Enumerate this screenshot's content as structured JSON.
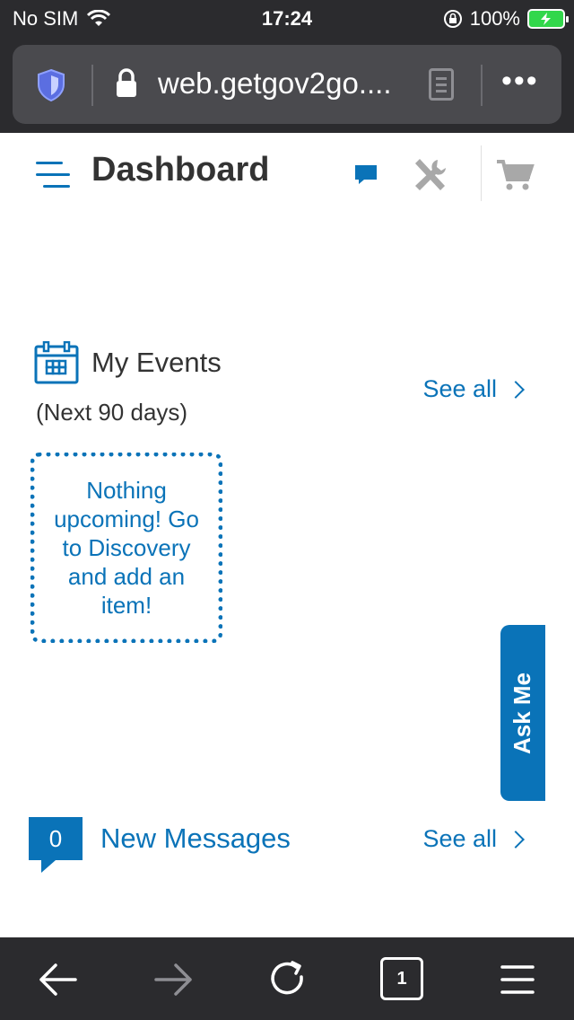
{
  "status_bar": {
    "carrier": "No SIM",
    "time": "17:24",
    "battery": "100%"
  },
  "browser": {
    "url": "web.getgov2go...."
  },
  "header": {
    "title": "Dashboard"
  },
  "events": {
    "title": "My Events",
    "subtitle": "(Next 90 days)",
    "see_all": "See all",
    "empty_text": "Nothing upcoming! Go to Discovery and add an item!"
  },
  "ask_me": {
    "label": "Ask Me"
  },
  "messages": {
    "count": "0",
    "title": "New Messages",
    "see_all": "See all"
  },
  "toolbar": {
    "tab_count": "1"
  },
  "colors": {
    "accent": "#0a73b8",
    "chrome": "#2b2b2e",
    "battery": "#32d74b"
  },
  "icons": [
    "wifi-icon",
    "orientation-lock-icon",
    "battery-icon",
    "shield-icon",
    "lock-icon",
    "reader-icon",
    "more-icon",
    "hamburger-icon",
    "chat-icon",
    "tools-icon",
    "cart-icon",
    "calendar-icon",
    "chevron-right-icon",
    "back-icon",
    "forward-icon",
    "reload-icon",
    "menu-icon"
  ]
}
